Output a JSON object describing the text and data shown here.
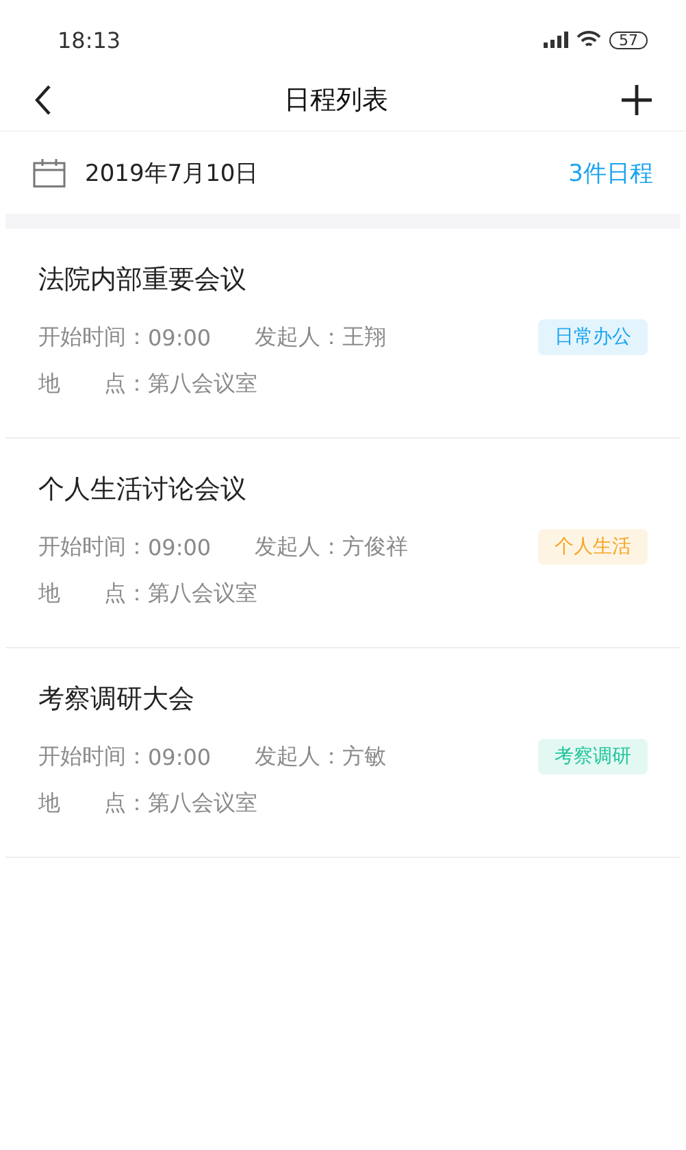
{
  "status_bar": {
    "time": "18:13",
    "battery": "57"
  },
  "nav": {
    "title": "日程列表"
  },
  "date_row": {
    "date": "2019年7月10日",
    "count": "3件日程"
  },
  "events": [
    {
      "title": "法院内部重要会议",
      "start_label": "开始时间：",
      "start": "09:00",
      "initiator_label": "发起人：",
      "initiator": "王翔",
      "tag": "日常办公",
      "color": "#1aa3f0",
      "location_label": "地　　点：",
      "location": "第八会议室"
    },
    {
      "title": "个人生活讨论会议",
      "start_label": "开始时间：",
      "start": "09:00",
      "initiator_label": "发起人：",
      "initiator": "方俊祥",
      "tag": "个人生活",
      "color": "#f5a623",
      "location_label": "地　　点：",
      "location": "第八会议室"
    },
    {
      "title": "考察调研大会",
      "start_label": "开始时间：",
      "start": "09:00",
      "initiator_label": "发起人：",
      "initiator": "方敏",
      "tag": "考察调研",
      "color": "#1fc59a",
      "location_label": "地　　点：",
      "location": "第八会议室"
    }
  ]
}
